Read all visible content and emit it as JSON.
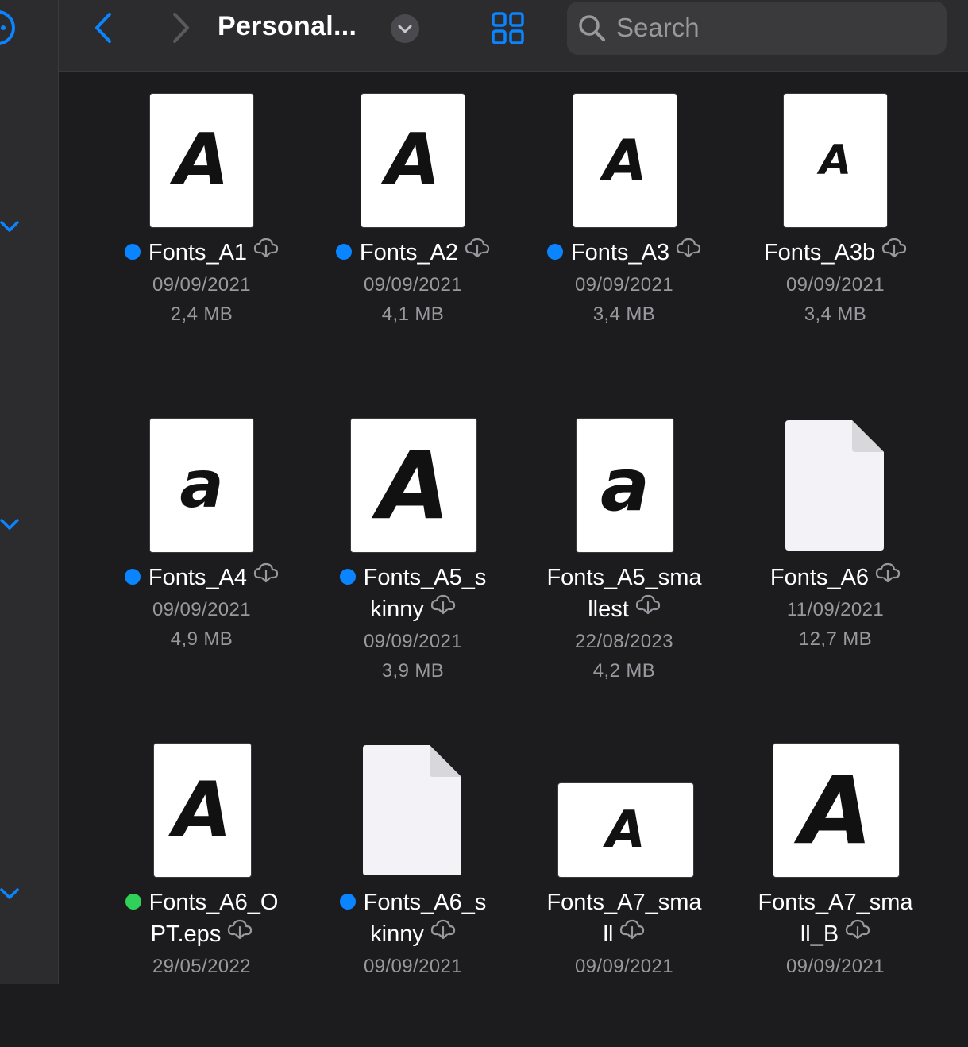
{
  "toolbar": {
    "title": "Personal...",
    "search_placeholder": "Search",
    "back_icon": "chevron-left-icon",
    "forward_icon": "chevron-right-icon",
    "view_icon": "grid-view-icon",
    "accent_color": "#0a84ff"
  },
  "files": [
    {
      "name": "Fonts_A1",
      "name_lines": [
        "Fonts_A1"
      ],
      "date": "09/09/2021",
      "size": "2,4 MB",
      "tag": "blue",
      "thumb": "A"
    },
    {
      "name": "Fonts_A2",
      "name_lines": [
        "Fonts_A2"
      ],
      "date": "09/09/2021",
      "size": "4,1 MB",
      "tag": "blue",
      "thumb": "A"
    },
    {
      "name": "Fonts_A3",
      "name_lines": [
        "Fonts_A3"
      ],
      "date": "09/09/2021",
      "size": "3,4 MB",
      "tag": "blue",
      "thumb": "A"
    },
    {
      "name": "Fonts_A3b",
      "name_lines": [
        "Fonts_A3b"
      ],
      "date": "09/09/2021",
      "size": "3,4 MB",
      "tag": "",
      "thumb": "A"
    },
    {
      "name": "Fonts_A4",
      "name_lines": [
        "Fonts_A4"
      ],
      "date": "09/09/2021",
      "size": "4,9 MB",
      "tag": "blue",
      "thumb": "a"
    },
    {
      "name": "Fonts_A5_skinny",
      "name_lines": [
        "Fonts_A5_s",
        "kinny"
      ],
      "date": "09/09/2021",
      "size": "3,9 MB",
      "tag": "blue",
      "thumb": "A"
    },
    {
      "name": "Fonts_A5_smallest",
      "name_lines": [
        "Fonts_A5_sma",
        "llest"
      ],
      "date": "22/08/2023",
      "size": "4,2 MB",
      "tag": "",
      "thumb": "a"
    },
    {
      "name": "Fonts_A6",
      "name_lines": [
        "Fonts_A6"
      ],
      "date": "11/09/2021",
      "size": "12,7 MB",
      "tag": "",
      "thumb": ""
    },
    {
      "name": "Fonts_A6_OPT.eps",
      "name_lines": [
        "Fonts_A6_O",
        "PT.eps"
      ],
      "date": "29/05/2022",
      "size": "",
      "tag": "green",
      "thumb": "A"
    },
    {
      "name": "Fonts_A6_skinny",
      "name_lines": [
        "Fonts_A6_s",
        "kinny"
      ],
      "date": "09/09/2021",
      "size": "",
      "tag": "blue",
      "thumb": ""
    },
    {
      "name": "Fonts_A7_small",
      "name_lines": [
        "Fonts_A7_sma",
        "ll"
      ],
      "date": "09/09/2021",
      "size": "",
      "tag": "",
      "thumb": "A"
    },
    {
      "name": "Fonts_A7_small_B",
      "name_lines": [
        "Fonts_A7_sma",
        "ll_B"
      ],
      "date": "09/09/2021",
      "size": "",
      "tag": "",
      "thumb": "A"
    }
  ],
  "tag_colors": {
    "blue": "#0a84ff",
    "green": "#30d158"
  },
  "icons": {
    "cloud": "cloud-download-icon",
    "sidebar_toggle": "chevron-down-icon"
  }
}
